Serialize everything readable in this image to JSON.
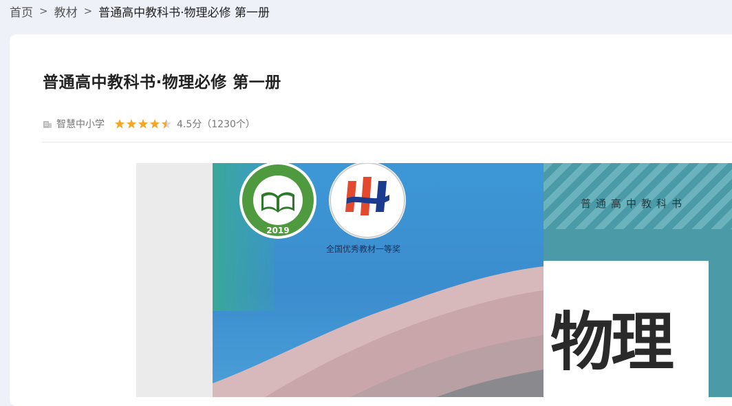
{
  "breadcrumb": {
    "home": "首页",
    "separator": ">",
    "category": "教材",
    "current": "普通高中教科书·物理必修 第一册"
  },
  "book": {
    "title": "普通高中教科书·物理必修 第一册",
    "publisher": "智慧中小学",
    "rating_stars": 4.5,
    "rating_text": "4.5分（1230个）"
  },
  "cover": {
    "series_label": "普通高中教科书",
    "subject": "物理",
    "badge_year": "2019",
    "award_caption": "全国优秀教材一等奖"
  },
  "colors": {
    "page_bg": "#eef1f8",
    "star": "#f5a623",
    "cover_blue": "#3b8dcd",
    "cover_teal": "#4a9aa8"
  },
  "icons": {
    "publisher": "building-icon",
    "rating": "star-icon"
  }
}
